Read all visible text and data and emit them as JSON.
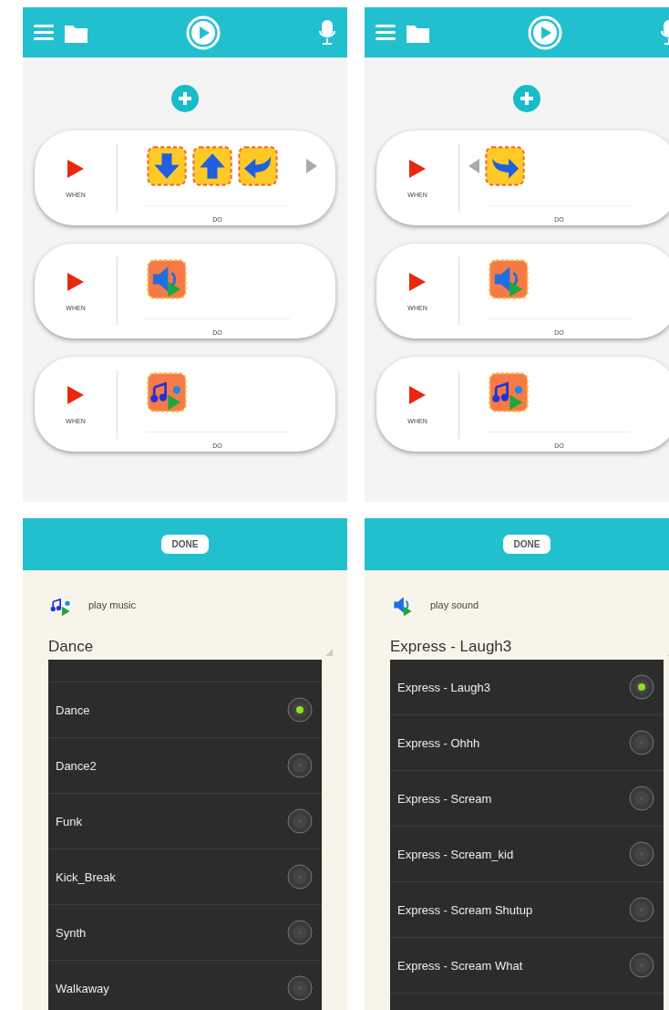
{
  "screens": [
    {
      "kind": "rules",
      "rules": [
        {
          "when": "WHEN",
          "do": "DO",
          "scroll_left": false,
          "scroll_right": true,
          "blocks": [
            {
              "kind": "down"
            },
            {
              "kind": "up"
            },
            {
              "kind": "turn_left"
            }
          ]
        },
        {
          "when": "WHEN",
          "do": "DO",
          "scroll_left": false,
          "scroll_right": false,
          "blocks": [
            {
              "kind": "sound"
            }
          ]
        },
        {
          "when": "WHEN",
          "do": "DO",
          "scroll_left": false,
          "scroll_right": false,
          "blocks": [
            {
              "kind": "music"
            }
          ]
        }
      ]
    },
    {
      "kind": "rules",
      "rules": [
        {
          "when": "WHEN",
          "do": "DO",
          "scroll_left": true,
          "scroll_right": false,
          "blocks": [
            {
              "kind": "turn_right"
            }
          ]
        },
        {
          "when": "WHEN",
          "do": "DO",
          "scroll_left": false,
          "scroll_right": false,
          "blocks": [
            {
              "kind": "sound"
            }
          ]
        },
        {
          "when": "WHEN",
          "do": "DO",
          "scroll_left": false,
          "scroll_right": false,
          "blocks": [
            {
              "kind": "music"
            }
          ]
        }
      ]
    },
    {
      "kind": "picker",
      "done": "DONE",
      "action": {
        "kind": "music",
        "label": "play music"
      },
      "value": "Dance",
      "clipped_top": true,
      "options": [
        {
          "label": "Dance",
          "selected": true
        },
        {
          "label": "Dance2",
          "selected": false
        },
        {
          "label": "Funk",
          "selected": false
        },
        {
          "label": "Kick_Break",
          "selected": false
        },
        {
          "label": "Synth",
          "selected": false
        },
        {
          "label": "Walkaway",
          "selected": false
        }
      ]
    },
    {
      "kind": "picker",
      "done": "DONE",
      "action": {
        "kind": "sound",
        "label": "play sound"
      },
      "value": "Express - Laugh3",
      "clipped_top": false,
      "options": [
        {
          "label": "Express - Laugh3",
          "selected": true
        },
        {
          "label": "Express - Ohhh",
          "selected": false
        },
        {
          "label": "Express - Scream",
          "selected": false
        },
        {
          "label": "Express - Scream_kid",
          "selected": false
        },
        {
          "label": "Express - Scream Shutup",
          "selected": false
        },
        {
          "label": "Express - Scream What",
          "selected": false
        }
      ]
    }
  ]
}
